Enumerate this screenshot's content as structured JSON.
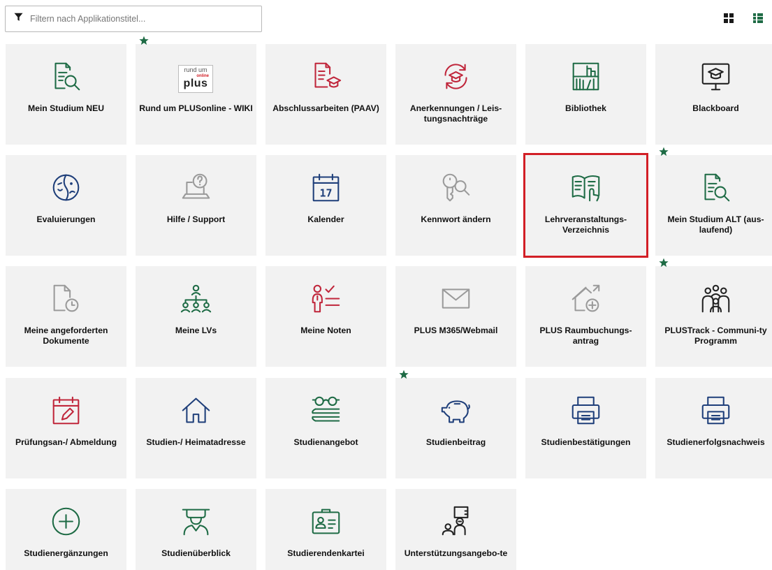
{
  "filter": {
    "placeholder": "Filtern nach Applikationstitel..."
  },
  "view_toggles": [
    {
      "name": "grid-view",
      "color": "#1a1a1a"
    },
    {
      "name": "list-view",
      "color": "#1e6b45"
    }
  ],
  "colors": {
    "green": "#1e6b45",
    "red": "#c0263b",
    "blue": "#1f3f7a",
    "gray": "#9a9a9a",
    "dark": "#222222",
    "highlight": "#d21f26"
  },
  "logo": {
    "line1": "rund um",
    "line2": "online",
    "line3": "plus"
  },
  "tiles": [
    {
      "label": "Mein Studium NEU",
      "icon": "document-search-icon",
      "favorite": false
    },
    {
      "label": "Rund um PLUSonline - WIKI",
      "icon": "plus-online-logo",
      "favorite": true
    },
    {
      "label": "Abschlussarbeiten (PAAV)",
      "icon": "document-graduation-icon",
      "favorite": false
    },
    {
      "label": "Anerkennungen / Leis-tungsnachträge",
      "icon": "graduation-cycle-icon",
      "favorite": false
    },
    {
      "label": "Bibliothek",
      "icon": "library-icon",
      "favorite": false
    },
    {
      "label": "Blackboard",
      "icon": "monitor-graduation-icon",
      "favorite": false
    },
    {
      "label": "Evaluierungen",
      "icon": "evaluation-face-icon",
      "favorite": false
    },
    {
      "label": "Hilfe / Support",
      "icon": "laptop-help-icon",
      "favorite": false
    },
    {
      "label": "Kalender",
      "icon": "calendar-icon",
      "favorite": false,
      "calendar_day": "17"
    },
    {
      "label": "Kennwort ändern",
      "icon": "key-search-icon",
      "favorite": false
    },
    {
      "label": "Lehrveranstaltungs-Verzeichnis",
      "icon": "book-pointer-icon",
      "favorite": false,
      "highlighted": true
    },
    {
      "label": "Mein Studium ALT (aus-laufend)",
      "icon": "document-search-icon",
      "favorite": true
    },
    {
      "label": "Meine angeforderten Dokumente",
      "icon": "document-clock-icon",
      "favorite": false
    },
    {
      "label": "Meine LVs",
      "icon": "people-hierarchy-icon",
      "favorite": false
    },
    {
      "label": "Meine Noten",
      "icon": "person-checklist-icon",
      "favorite": false
    },
    {
      "label": "PLUS M365/Webmail",
      "icon": "mail-icon",
      "favorite": false
    },
    {
      "label": "PLUS Raumbuchungs-antrag",
      "icon": "house-add-icon",
      "favorite": false
    },
    {
      "label": "PLUSTrack - Communi-ty Programm",
      "icon": "community-icon",
      "favorite": true
    },
    {
      "label": "Prüfungsan-/ Abmeldung",
      "icon": "calendar-edit-icon",
      "favorite": false
    },
    {
      "label": "Studien-/ Heimatadresse",
      "icon": "home-icon",
      "favorite": false
    },
    {
      "label": "Studienangebot",
      "icon": "glasses-books-icon",
      "favorite": false
    },
    {
      "label": "Studienbeitrag",
      "icon": "piggy-bank-icon",
      "favorite": true
    },
    {
      "label": "Studienbestätigungen",
      "icon": "printer-icon",
      "favorite": false
    },
    {
      "label": "Studienerfolgsnachweis",
      "icon": "printer-icon",
      "favorite": false
    },
    {
      "label": "Studienergänzungen",
      "icon": "circle-plus-icon",
      "favorite": false
    },
    {
      "label": "Studienüberblick",
      "icon": "graduate-person-icon",
      "favorite": false
    },
    {
      "label": "Studierendenkartei",
      "icon": "id-card-icon",
      "favorite": false
    },
    {
      "label": "Unterstützungsangebo-te",
      "icon": "support-person-icon",
      "favorite": false
    }
  ]
}
